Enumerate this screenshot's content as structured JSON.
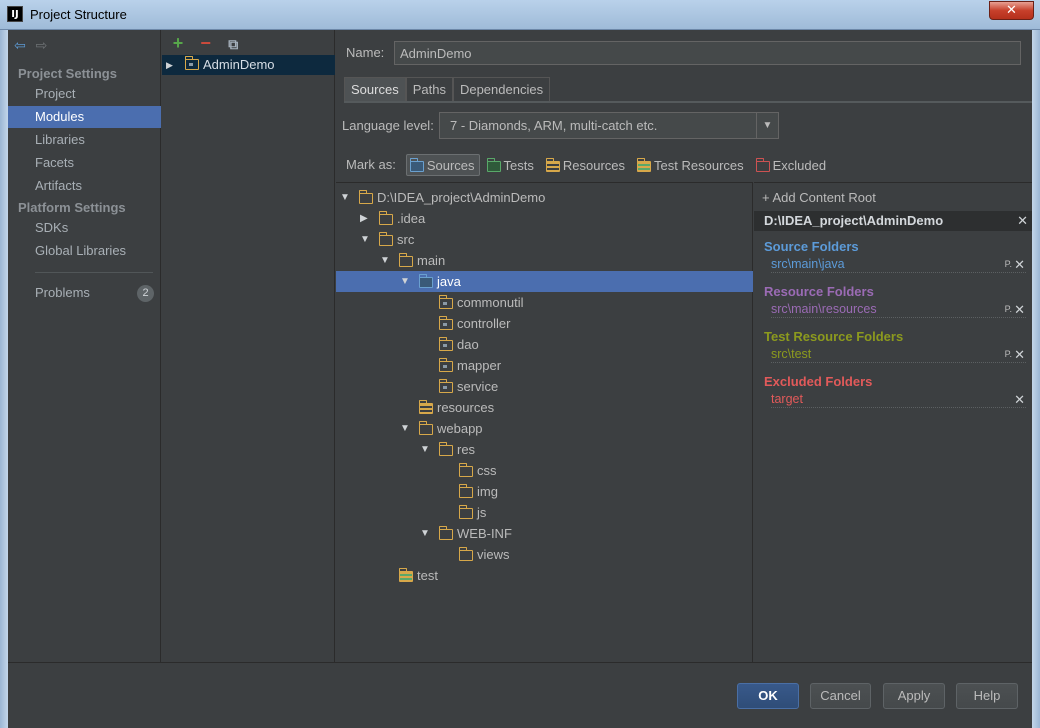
{
  "window": {
    "title": "Project Structure",
    "app_icon": "IJ",
    "close": "✕"
  },
  "sidebar": {
    "project_settings": "Project Settings",
    "platform_settings": "Platform Settings",
    "items": [
      "Project",
      "Modules",
      "Libraries",
      "Facets",
      "Artifacts"
    ],
    "platform_items": [
      "SDKs",
      "Global Libraries"
    ],
    "problems": {
      "label": "Problems",
      "count": "2"
    }
  },
  "modules": {
    "toolbar": {
      "add": "+",
      "remove": "−",
      "copy": "⧉"
    },
    "items": [
      {
        "name": "AdminDemo"
      }
    ]
  },
  "main": {
    "name_label": "Name:",
    "name_value": "AdminDemo",
    "tabs": [
      "Sources",
      "Paths",
      "Dependencies"
    ],
    "language_label": "Language level:",
    "language_value": "7 - Diamonds, ARM, multi-catch etc.",
    "mark_as": {
      "label": "Mark as:",
      "buttons": [
        "Sources",
        "Tests",
        "Resources",
        "Test Resources",
        "Excluded"
      ]
    },
    "tree": [
      {
        "label": "D:\\IDEA_project\\AdminDemo",
        "depth": 0,
        "expanded": true
      },
      {
        "label": ".idea",
        "depth": 1,
        "expanded": false
      },
      {
        "label": "src",
        "depth": 1,
        "expanded": true
      },
      {
        "label": "main",
        "depth": 2,
        "expanded": true
      },
      {
        "label": "java",
        "depth": 3,
        "expanded": true,
        "selected": true
      },
      {
        "label": "commonutil",
        "depth": 4
      },
      {
        "label": "controller",
        "depth": 4
      },
      {
        "label": "dao",
        "depth": 4
      },
      {
        "label": "mapper",
        "depth": 4
      },
      {
        "label": "service",
        "depth": 4
      },
      {
        "label": "resources",
        "depth": 3
      },
      {
        "label": "webapp",
        "depth": 3,
        "expanded": true
      },
      {
        "label": "res",
        "depth": 4,
        "expanded": true
      },
      {
        "label": "css",
        "depth": 5
      },
      {
        "label": "img",
        "depth": 5
      },
      {
        "label": "js",
        "depth": 5
      },
      {
        "label": "WEB-INF",
        "depth": 4,
        "expanded": true
      },
      {
        "label": "views",
        "depth": 5
      },
      {
        "label": "test",
        "depth": 2
      }
    ],
    "content_root": {
      "add_label": "+ Add Content Root",
      "root_path": "D:\\IDEA_project\\AdminDemo",
      "sections": [
        {
          "title": "Source Folders",
          "item": "src\\main\\java",
          "color": "#5c9bd9"
        },
        {
          "title": "Resource Folders",
          "item": "src\\main\\resources",
          "color": "#9b6bb5"
        },
        {
          "title": "Test Resource Folders",
          "item": "src\\test",
          "color": "#8c9a1e"
        },
        {
          "title": "Excluded Folders",
          "item": "target",
          "color": "#e25a5a"
        }
      ]
    }
  },
  "buttons": {
    "ok": "OK",
    "cancel": "Cancel",
    "apply": "Apply",
    "help": "Help"
  }
}
